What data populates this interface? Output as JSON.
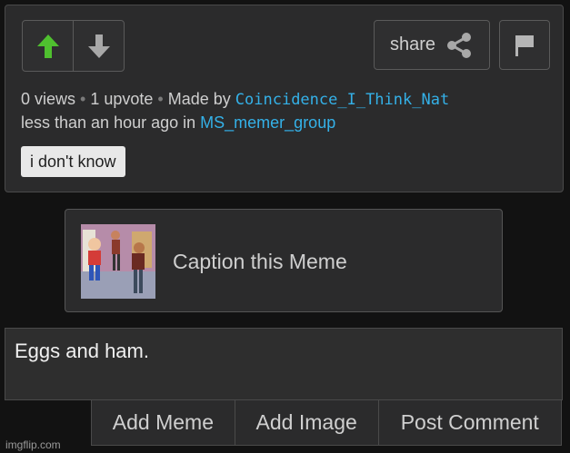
{
  "post": {
    "share_label": "share",
    "stats": {
      "views": "0 views",
      "upvotes": "1 upvote",
      "made_by_prefix": "Made by",
      "author": "Coincidence_I_Think_Nat",
      "time_text": "less than an hour ago in",
      "group": "MS_memer_group"
    },
    "tag": "i don't know",
    "icons": {
      "upvote": "up-arrow-icon",
      "downvote": "down-arrow-icon",
      "share": "share-icon",
      "flag": "flag-icon"
    }
  },
  "caption_card": {
    "label": "Caption this Meme"
  },
  "comment": {
    "value": "Eggs and ham."
  },
  "actions": {
    "add_meme": "Add Meme",
    "add_image": "Add Image",
    "post_comment": "Post Comment"
  },
  "watermark": "imgflip.com",
  "colors": {
    "upvote_active": "#4fc02f",
    "link": "#34b1e8"
  }
}
